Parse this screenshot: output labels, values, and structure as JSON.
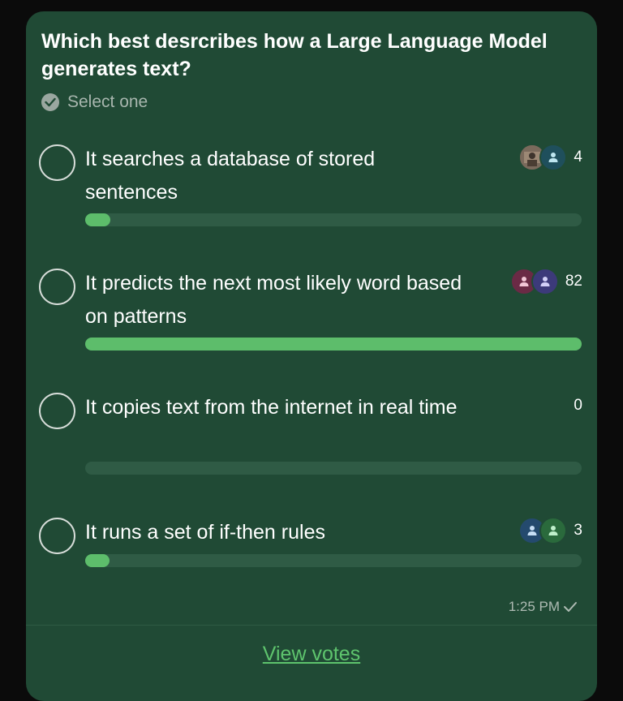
{
  "poll": {
    "question": "Which best desrcribes how a Large Language Model generates text?",
    "subtitle": "Select one",
    "options": [
      {
        "text": "It searches a database of stored sentences",
        "votes": "4",
        "fraction": 0.05,
        "voters": [
          "photo-avatar",
          "person-icon"
        ]
      },
      {
        "text": "It predicts the next most likely word based on patterns",
        "votes": "82",
        "fraction": 1.0,
        "voters": [
          "person-icon",
          "person-icon"
        ]
      },
      {
        "text": "It copies text from the internet in real time",
        "votes": "0",
        "fraction": 0.0,
        "voters": []
      },
      {
        "text": "It runs a set of if-then rules",
        "votes": "3",
        "fraction": 0.04,
        "voters": [
          "person-icon",
          "person-icon"
        ]
      }
    ]
  },
  "meta": {
    "time": "1:25 PM",
    "read_status": "check-icon"
  },
  "footer": {
    "view_votes": "View votes"
  },
  "colors": {
    "card_bg": "#204a35",
    "bar_fill": "#5dbd6b",
    "link": "#5ec46d"
  }
}
